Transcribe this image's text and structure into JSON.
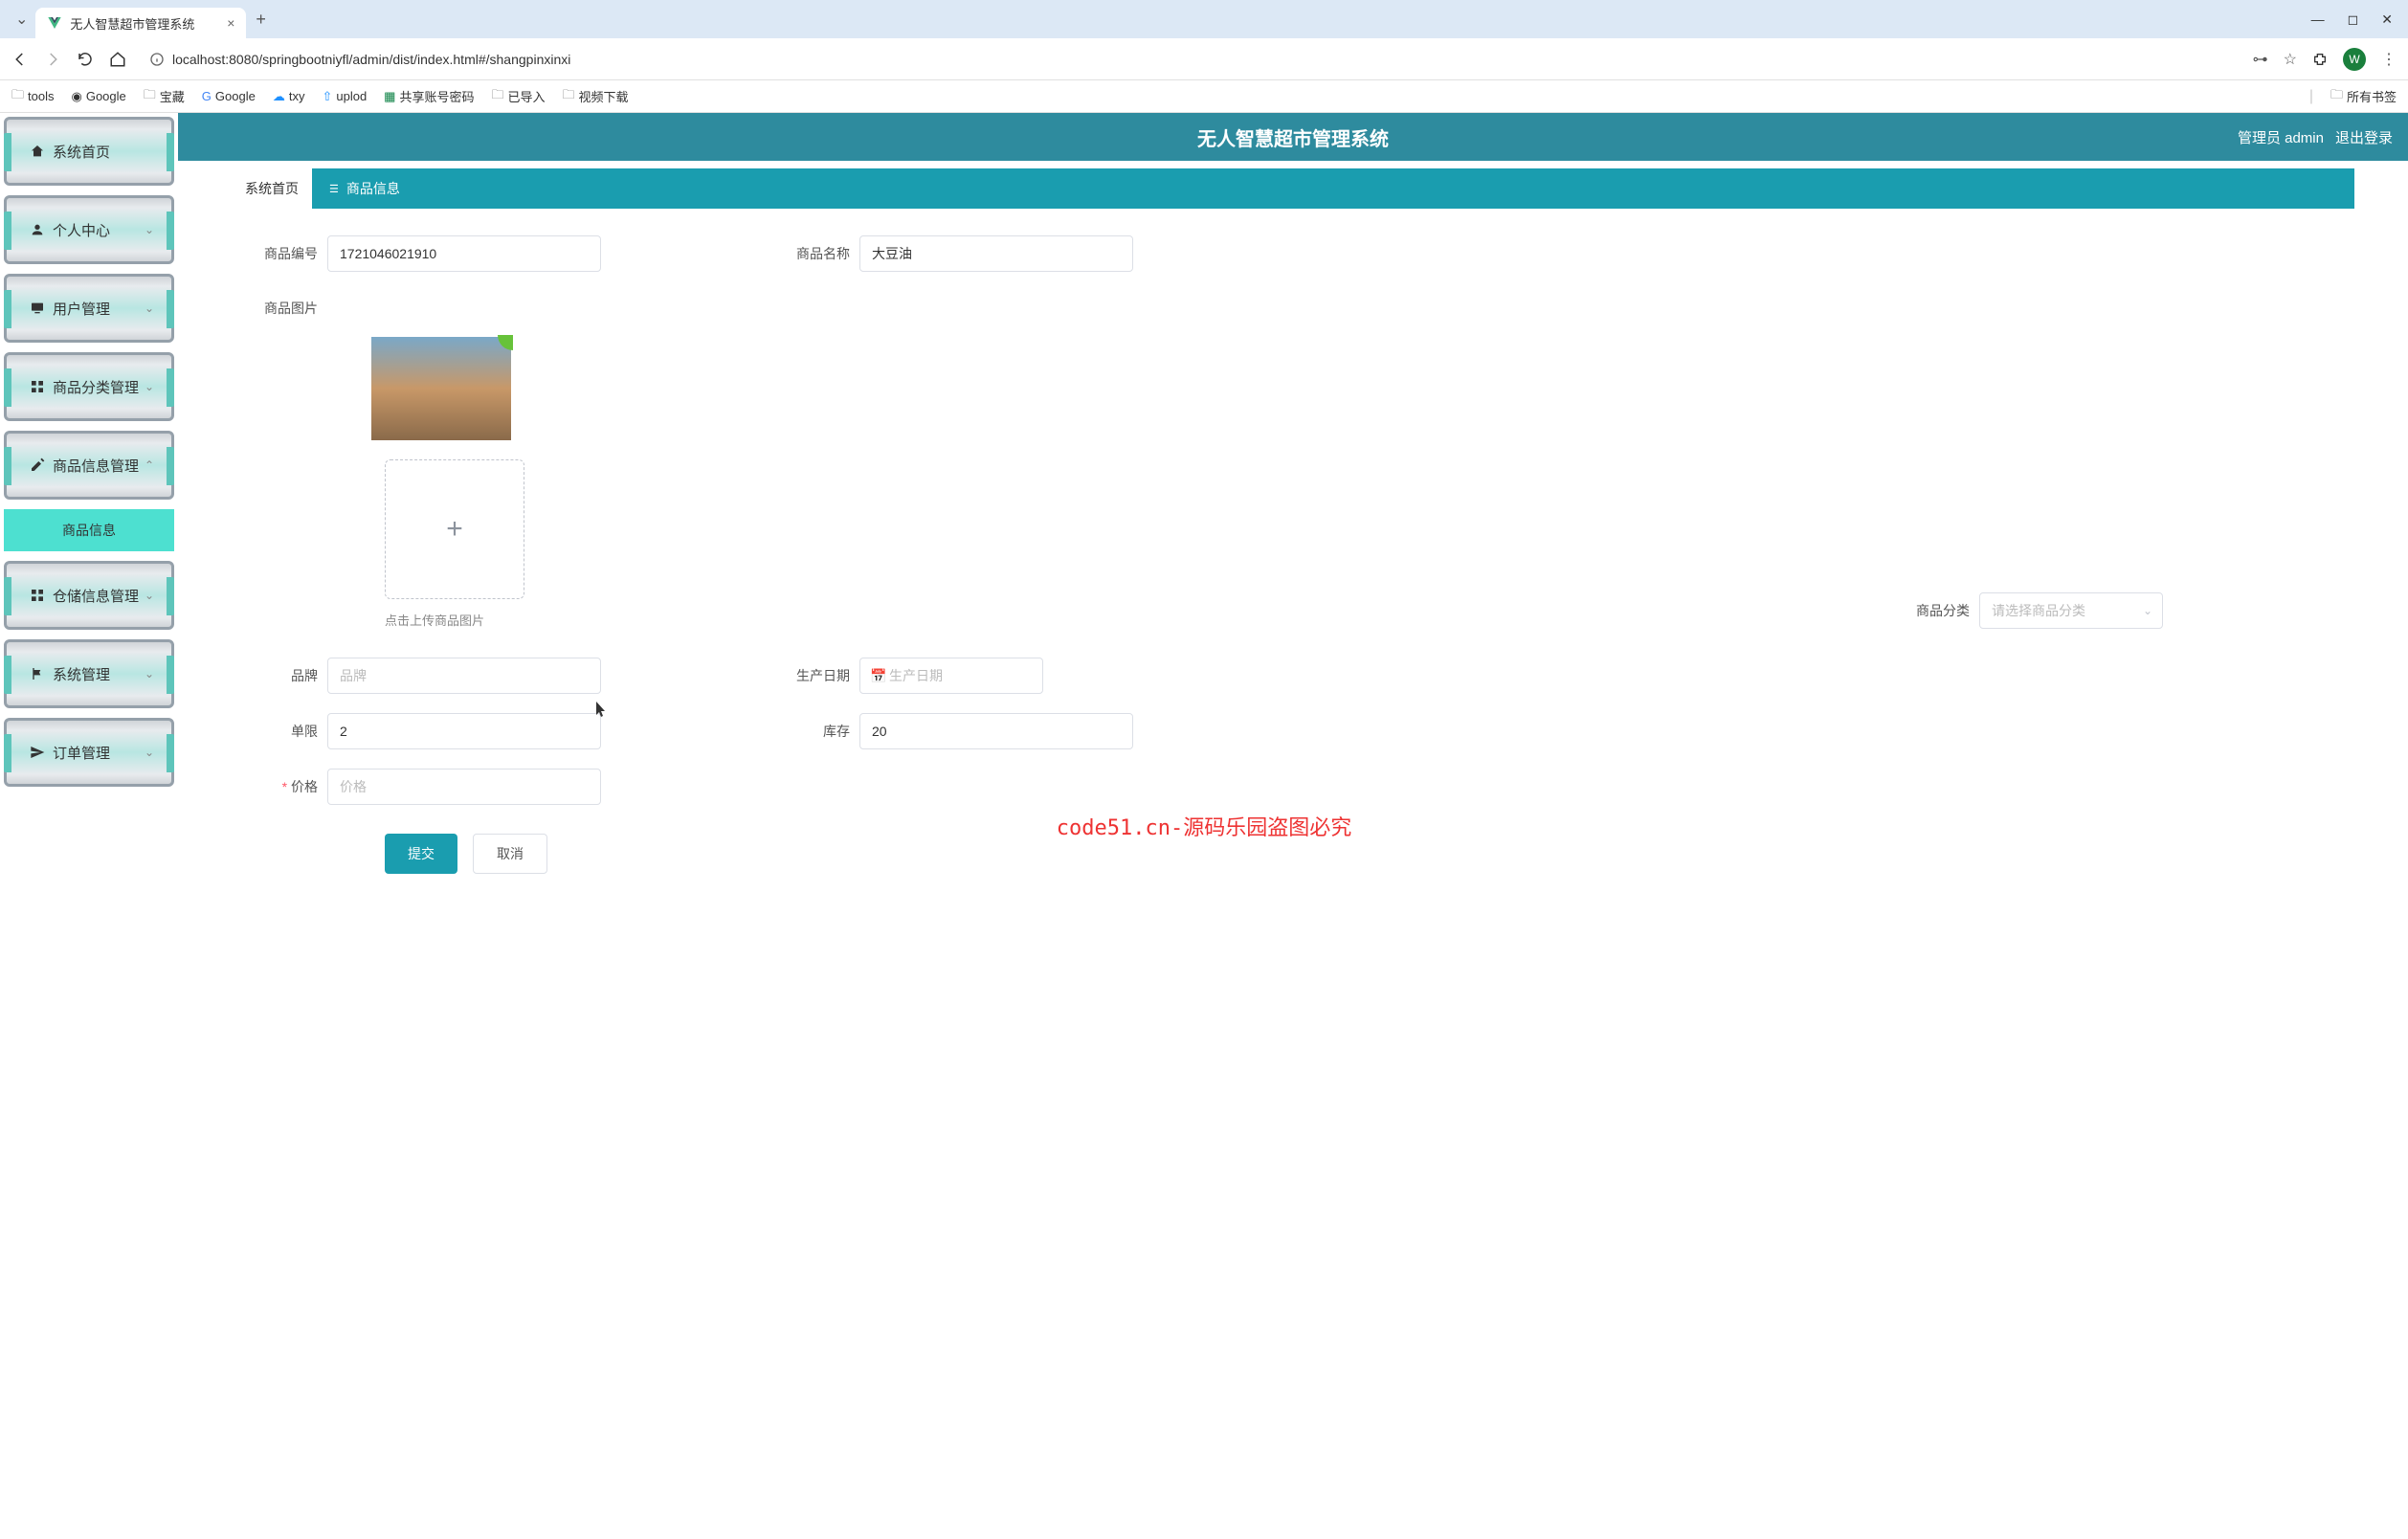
{
  "browser": {
    "tab_title": "无人智慧超市管理系统",
    "url": "localhost:8080/springbootniyfl/admin/dist/index.html#/shangpinxinxi",
    "avatar_letter": "W",
    "bookmarks": [
      {
        "icon": "folder",
        "label": "tools"
      },
      {
        "icon": "google",
        "label": "Google"
      },
      {
        "icon": "folder",
        "label": "宝藏"
      },
      {
        "icon": "google",
        "label": "Google"
      },
      {
        "icon": "cloud",
        "label": "txy"
      },
      {
        "icon": "upload",
        "label": "uplod"
      },
      {
        "icon": "sheet",
        "label": "共享账号密码"
      },
      {
        "icon": "folder",
        "label": "已导入"
      },
      {
        "icon": "folder",
        "label": "视频下载"
      }
    ],
    "all_bookmarks": "所有书签"
  },
  "app": {
    "title": "无人智慧超市管理系统",
    "user_label": "管理员 admin",
    "logout": "退出登录"
  },
  "sidebar": {
    "items": [
      {
        "icon": "home",
        "label": "系统首页",
        "chevron": ""
      },
      {
        "icon": "user",
        "label": "个人中心",
        "chevron": "⌄"
      },
      {
        "icon": "monitor",
        "label": "用户管理",
        "chevron": "⌄"
      },
      {
        "icon": "grid",
        "label": "商品分类管理",
        "chevron": "⌄"
      },
      {
        "icon": "edit",
        "label": "商品信息管理",
        "chevron": "⌃"
      },
      {
        "icon": "grid",
        "label": "仓储信息管理",
        "chevron": "⌄"
      },
      {
        "icon": "flag",
        "label": "系统管理",
        "chevron": "⌄"
      },
      {
        "icon": "send",
        "label": "订单管理",
        "chevron": "⌄"
      }
    ],
    "submenu": "商品信息"
  },
  "breadcrumb": {
    "home": "系统首页",
    "current": "商品信息"
  },
  "form": {
    "product_code_label": "商品编号",
    "product_code_value": "1721046021910",
    "product_name_label": "商品名称",
    "product_name_value": "大豆油",
    "product_image_label": "商品图片",
    "upload_hint": "点击上传商品图片",
    "category_label": "商品分类",
    "category_placeholder": "请选择商品分类",
    "brand_label": "品牌",
    "brand_placeholder": "品牌",
    "prod_date_label": "生产日期",
    "prod_date_placeholder": "生产日期",
    "limit_label": "单限",
    "limit_value": "2",
    "stock_label": "库存",
    "stock_value": "20",
    "price_label": "价格",
    "price_placeholder": "价格",
    "submit": "提交",
    "cancel": "取消"
  },
  "watermark": "code51.cn-源码乐园盗图必究"
}
